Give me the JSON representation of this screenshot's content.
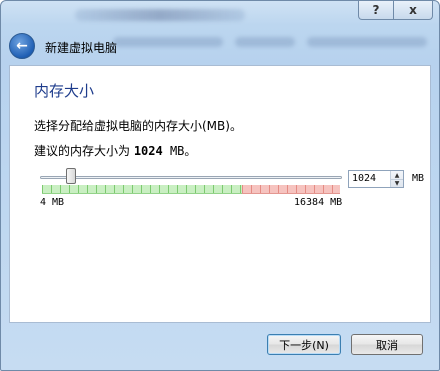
{
  "titlebar": {
    "help_label": "?",
    "close_label": "x"
  },
  "header": {
    "back_icon": "back-arrow-icon",
    "title": "新建虚拟电脑"
  },
  "page": {
    "title": "内存大小",
    "description": "选择分配给虚拟电脑的内存大小(MB)。",
    "recommend_prefix": "建议的内存大小为 ",
    "recommend_value": "1024",
    "recommend_suffix": " MB。"
  },
  "memory": {
    "min_label": "4 MB",
    "max_label": "16384 MB",
    "value": "1024",
    "unit": "MB",
    "slider_fraction": 0.0623,
    "safe_fraction": 0.67
  },
  "buttons": {
    "next": "下一步(N)",
    "cancel": "取消"
  }
}
